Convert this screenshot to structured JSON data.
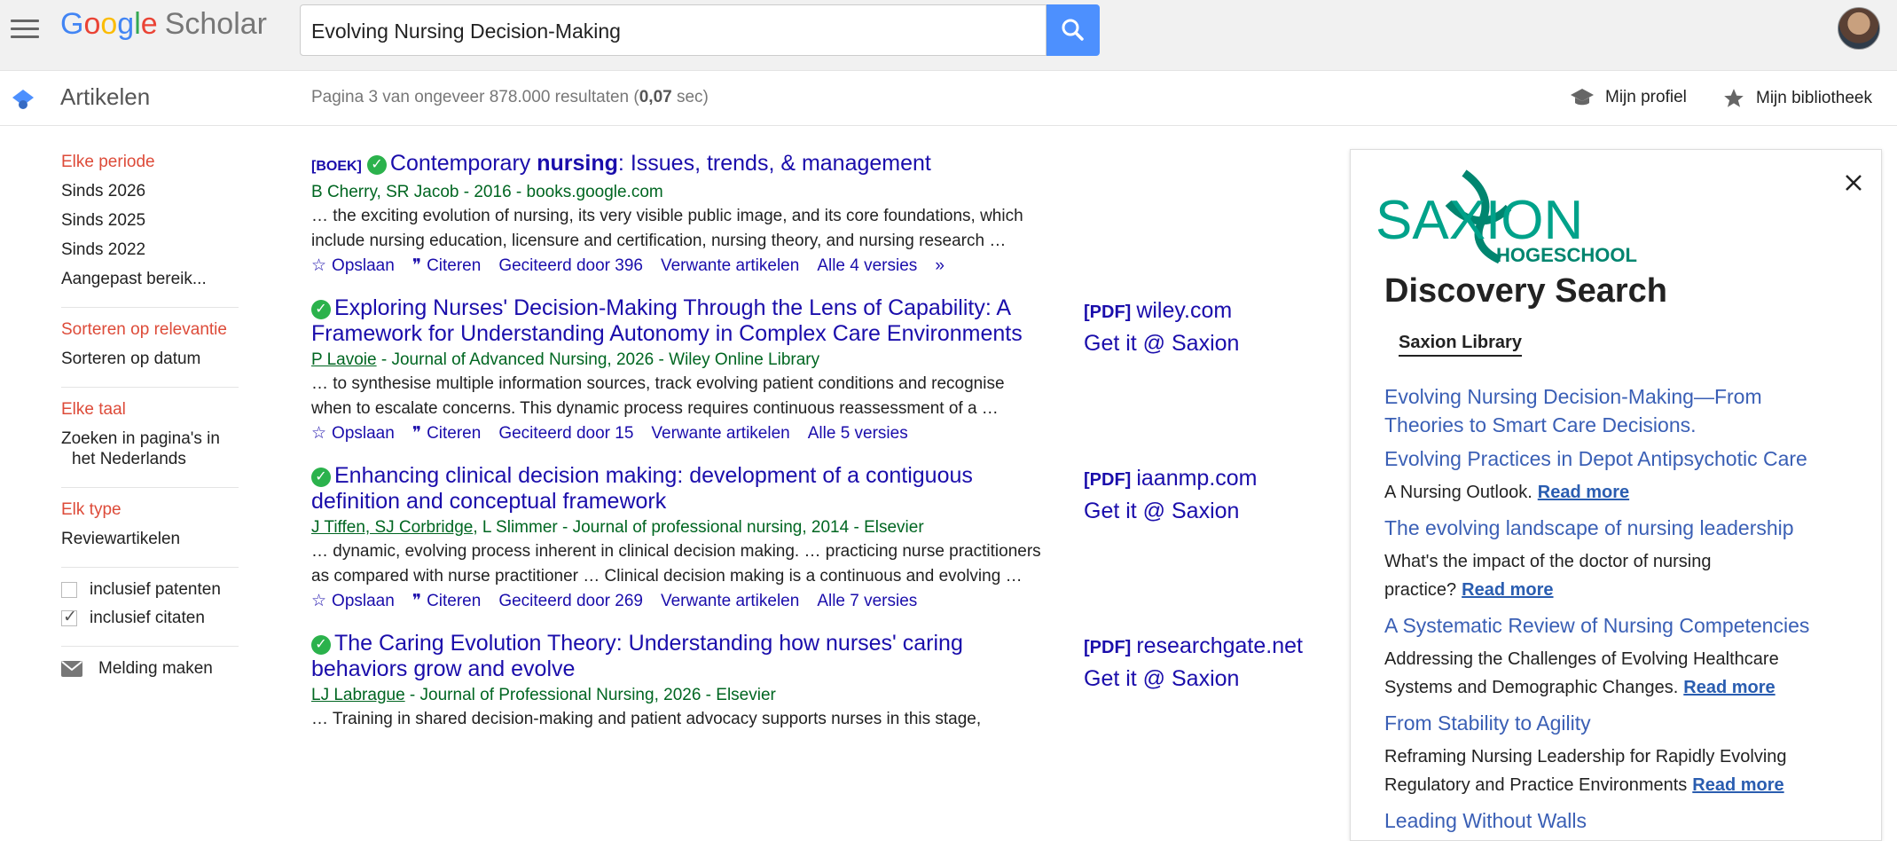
{
  "header": {
    "logo_letters": [
      "G",
      "o",
      "o",
      "g",
      "l",
      "e"
    ],
    "logo_suffix": "Scholar",
    "search_value": "Evolving Nursing Decision-Making"
  },
  "subbar": {
    "section": "Artikelen",
    "stats_prefix": "Pagina 3 van ongeveer 878.000 resultaten (",
    "stats_time": "0,07",
    "stats_suffix": " sec)",
    "profile": "Mijn profiel",
    "library": "Mijn bibliotheek"
  },
  "sidebar": {
    "period_heading": "Elke periode",
    "period_items": [
      "Sinds 2026",
      "Sinds 2025",
      "Sinds 2022",
      "Aangepast bereik..."
    ],
    "sort_heading": "Sorteren op relevantie",
    "sort_item": "Sorteren op datum",
    "lang_heading": "Elke taal",
    "lang_item_1": "Zoeken in pagina's in",
    "lang_item_2": "het Nederlands",
    "type_heading": "Elk type",
    "type_item": "Reviewartikelen",
    "patents": "inclusief patenten",
    "citations": "inclusief citaten",
    "alert": "Melding maken"
  },
  "results": [
    {
      "tag": "[BOEK]",
      "title_parts": [
        "Contemporary ",
        "nursing",
        ": Issues, trends, & management"
      ],
      "meta": "B Cherry, SR Jacob - 2016 - books.google.com",
      "snippet_1": "… the exciting evolution of nursing, its very visible public image, and its core foundations, which",
      "snippet_2": "include nursing education, licensure and certification, nursing theory, and nursing research …",
      "save": "Opslaan",
      "cite": "Citeren",
      "cited_by": "Geciteerd door 396",
      "related": "Verwante artikelen",
      "versions": "Alle 4 versies"
    },
    {
      "title_1": "Exploring Nurses' Decision-Making Through the Lens of Capability: A",
      "title_2": "Framework for Understanding Autonomy in Complex Care Environments",
      "meta_author": "P Lavoie",
      "meta_rest": " - Journal of Advanced Nursing, 2026 - Wiley Online Library",
      "snippet_1": "… to synthesise multiple information sources, track evolving patient conditions and recognise",
      "snippet_2": "when to escalate concerns. This dynamic process requires continuous reassessment of a …",
      "save": "Opslaan",
      "cite": "Citeren",
      "cited_by": "Geciteerd door 15",
      "related": "Verwante artikelen",
      "versions": "Alle 5 versies",
      "pdf": "[PDF]",
      "source": "wiley.com",
      "getit": "Get it @ Saxion"
    },
    {
      "title_1": "Enhancing clinical decision making: development of a contiguous",
      "title_2": "definition and conceptual framework",
      "meta_authors": "J Tiffen, SJ Corbridge",
      "meta_rest": ", L Slimmer - Journal of professional nursing, 2014 - Elsevier",
      "snippet_1": "… dynamic, evolving process inherent in clinical decision making. … practicing nurse practitioners",
      "snippet_2": "as compared with nurse practitioner … Clinical decision making is a continuous and evolving …",
      "save": "Opslaan",
      "cite": "Citeren",
      "cited_by": "Geciteerd door 269",
      "related": "Verwante artikelen",
      "versions": "Alle 7 versies",
      "pdf": "[PDF]",
      "source": "iaanmp.com",
      "getit": "Get it @ Saxion"
    },
    {
      "title_1": "The Caring Evolution Theory: Understanding how nurses' caring",
      "title_2": "behaviors grow and evolve",
      "meta_author": "LJ Labrague",
      "meta_rest": " - Journal of Professional Nursing, 2026 - Elsevier",
      "snippet_1": "… Training in shared decision-making and patient advocacy supports nurses in this stage,",
      "pdf": "[PDF]",
      "source": "researchgate.net",
      "getit": "Get it @ Saxion"
    }
  ],
  "panel": {
    "logo_text": "SAXION",
    "logo_sub": "HOGESCHOOL",
    "title": "Discovery Search",
    "tab": "Saxion Library",
    "items": [
      {
        "title_1": "Evolving Nursing Decision-Making—From",
        "title_2": "Theories to Smart Care Decisions."
      },
      {
        "title_1": "Evolving Practices in Depot Antipsychotic Care",
        "desc_1": "A Nursing Outlook.",
        "more": "Read more"
      },
      {
        "title_1": "The evolving landscape of nursing leadership",
        "desc_1": "What's the impact of the doctor of nursing",
        "desc_2": "practice?",
        "more": "Read more"
      },
      {
        "title_1": "A Systematic Review of Nursing Competencies",
        "desc_1": "Addressing the Challenges of Evolving Healthcare",
        "desc_2": "Systems and Demographic Changes.",
        "more": "Read more"
      },
      {
        "title_1": "From Stability to Agility",
        "desc_1": "Reframing Nursing Leadership for Rapidly Evolving",
        "desc_2": "Regulatory and Practice Environments",
        "more": "Read more"
      },
      {
        "title_1": "Leading Without Walls"
      }
    ]
  }
}
